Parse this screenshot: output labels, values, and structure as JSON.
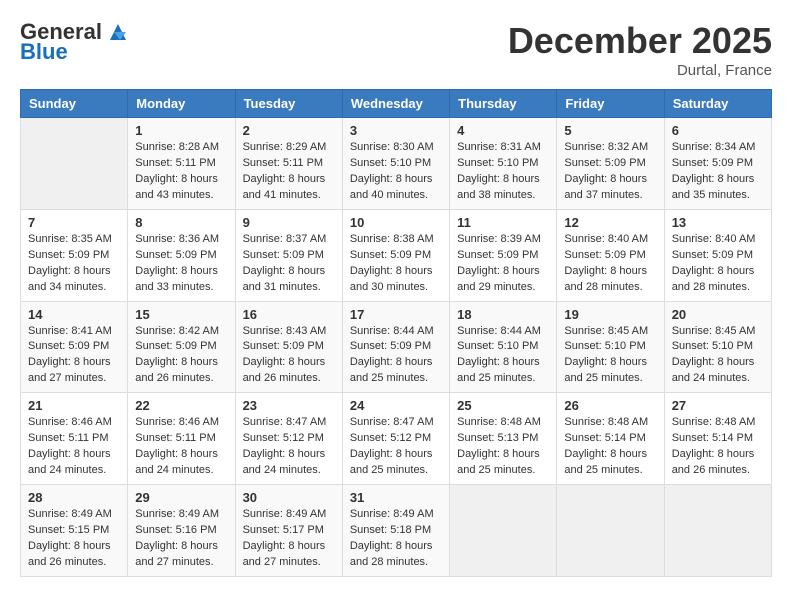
{
  "header": {
    "logo_general": "General",
    "logo_blue": "Blue",
    "month": "December 2025",
    "location": "Durtal, France"
  },
  "weekdays": [
    "Sunday",
    "Monday",
    "Tuesday",
    "Wednesday",
    "Thursday",
    "Friday",
    "Saturday"
  ],
  "weeks": [
    [
      {
        "day": "",
        "info": ""
      },
      {
        "day": "1",
        "info": "Sunrise: 8:28 AM\nSunset: 5:11 PM\nDaylight: 8 hours\nand 43 minutes."
      },
      {
        "day": "2",
        "info": "Sunrise: 8:29 AM\nSunset: 5:11 PM\nDaylight: 8 hours\nand 41 minutes."
      },
      {
        "day": "3",
        "info": "Sunrise: 8:30 AM\nSunset: 5:10 PM\nDaylight: 8 hours\nand 40 minutes."
      },
      {
        "day": "4",
        "info": "Sunrise: 8:31 AM\nSunset: 5:10 PM\nDaylight: 8 hours\nand 38 minutes."
      },
      {
        "day": "5",
        "info": "Sunrise: 8:32 AM\nSunset: 5:09 PM\nDaylight: 8 hours\nand 37 minutes."
      },
      {
        "day": "6",
        "info": "Sunrise: 8:34 AM\nSunset: 5:09 PM\nDaylight: 8 hours\nand 35 minutes."
      }
    ],
    [
      {
        "day": "7",
        "info": "Sunrise: 8:35 AM\nSunset: 5:09 PM\nDaylight: 8 hours\nand 34 minutes."
      },
      {
        "day": "8",
        "info": "Sunrise: 8:36 AM\nSunset: 5:09 PM\nDaylight: 8 hours\nand 33 minutes."
      },
      {
        "day": "9",
        "info": "Sunrise: 8:37 AM\nSunset: 5:09 PM\nDaylight: 8 hours\nand 31 minutes."
      },
      {
        "day": "10",
        "info": "Sunrise: 8:38 AM\nSunset: 5:09 PM\nDaylight: 8 hours\nand 30 minutes."
      },
      {
        "day": "11",
        "info": "Sunrise: 8:39 AM\nSunset: 5:09 PM\nDaylight: 8 hours\nand 29 minutes."
      },
      {
        "day": "12",
        "info": "Sunrise: 8:40 AM\nSunset: 5:09 PM\nDaylight: 8 hours\nand 28 minutes."
      },
      {
        "day": "13",
        "info": "Sunrise: 8:40 AM\nSunset: 5:09 PM\nDaylight: 8 hours\nand 28 minutes."
      }
    ],
    [
      {
        "day": "14",
        "info": "Sunrise: 8:41 AM\nSunset: 5:09 PM\nDaylight: 8 hours\nand 27 minutes."
      },
      {
        "day": "15",
        "info": "Sunrise: 8:42 AM\nSunset: 5:09 PM\nDaylight: 8 hours\nand 26 minutes."
      },
      {
        "day": "16",
        "info": "Sunrise: 8:43 AM\nSunset: 5:09 PM\nDaylight: 8 hours\nand 26 minutes."
      },
      {
        "day": "17",
        "info": "Sunrise: 8:44 AM\nSunset: 5:09 PM\nDaylight: 8 hours\nand 25 minutes."
      },
      {
        "day": "18",
        "info": "Sunrise: 8:44 AM\nSunset: 5:10 PM\nDaylight: 8 hours\nand 25 minutes."
      },
      {
        "day": "19",
        "info": "Sunrise: 8:45 AM\nSunset: 5:10 PM\nDaylight: 8 hours\nand 25 minutes."
      },
      {
        "day": "20",
        "info": "Sunrise: 8:45 AM\nSunset: 5:10 PM\nDaylight: 8 hours\nand 24 minutes."
      }
    ],
    [
      {
        "day": "21",
        "info": "Sunrise: 8:46 AM\nSunset: 5:11 PM\nDaylight: 8 hours\nand 24 minutes."
      },
      {
        "day": "22",
        "info": "Sunrise: 8:46 AM\nSunset: 5:11 PM\nDaylight: 8 hours\nand 24 minutes."
      },
      {
        "day": "23",
        "info": "Sunrise: 8:47 AM\nSunset: 5:12 PM\nDaylight: 8 hours\nand 24 minutes."
      },
      {
        "day": "24",
        "info": "Sunrise: 8:47 AM\nSunset: 5:12 PM\nDaylight: 8 hours\nand 25 minutes."
      },
      {
        "day": "25",
        "info": "Sunrise: 8:48 AM\nSunset: 5:13 PM\nDaylight: 8 hours\nand 25 minutes."
      },
      {
        "day": "26",
        "info": "Sunrise: 8:48 AM\nSunset: 5:14 PM\nDaylight: 8 hours\nand 25 minutes."
      },
      {
        "day": "27",
        "info": "Sunrise: 8:48 AM\nSunset: 5:14 PM\nDaylight: 8 hours\nand 26 minutes."
      }
    ],
    [
      {
        "day": "28",
        "info": "Sunrise: 8:49 AM\nSunset: 5:15 PM\nDaylight: 8 hours\nand 26 minutes."
      },
      {
        "day": "29",
        "info": "Sunrise: 8:49 AM\nSunset: 5:16 PM\nDaylight: 8 hours\nand 27 minutes."
      },
      {
        "day": "30",
        "info": "Sunrise: 8:49 AM\nSunset: 5:17 PM\nDaylight: 8 hours\nand 27 minutes."
      },
      {
        "day": "31",
        "info": "Sunrise: 8:49 AM\nSunset: 5:18 PM\nDaylight: 8 hours\nand 28 minutes."
      },
      {
        "day": "",
        "info": ""
      },
      {
        "day": "",
        "info": ""
      },
      {
        "day": "",
        "info": ""
      }
    ]
  ]
}
